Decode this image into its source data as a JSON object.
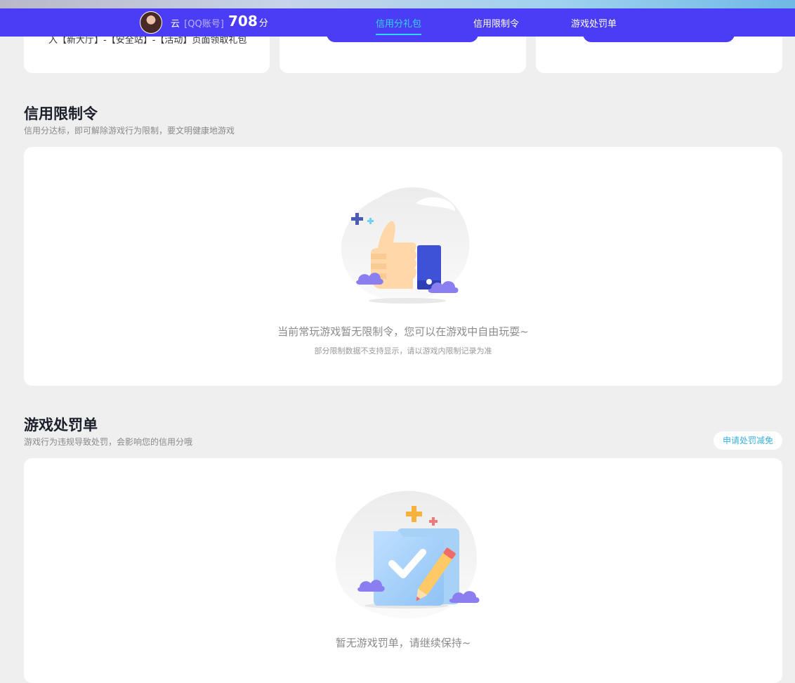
{
  "header": {
    "user_name": "云",
    "account_type": "[QQ账号]",
    "score": "708",
    "score_unit": "分",
    "tabs": [
      {
        "label": "信用分礼包",
        "active": true
      },
      {
        "label": "信用限制令",
        "active": false
      },
      {
        "label": "游戏处罚单",
        "active": false
      }
    ]
  },
  "gift_cards": {
    "card1_text": "入【新大厅】-【安全站】-【活动】页面领取礼包"
  },
  "restriction_section": {
    "title": "信用限制令",
    "subtitle": "信用分达标，即可解除游戏行为限制，要文明健康地游戏",
    "empty_main": "当前常玩游戏暂无限制令，您可以在游戏中自由玩耍~",
    "empty_sub": "部分限制数据不支持显示，请以游戏内限制记录为准"
  },
  "penalty_section": {
    "title": "游戏处罚单",
    "subtitle": "游戏行为违规导致处罚，会影响您的信用分哦",
    "action_label": "申请处罚减免",
    "empty_main": "暂无游戏罚单，请继续保持~"
  },
  "colors": {
    "brand": "#4b3df5",
    "active_tab": "#30d6f5",
    "link": "#3aaee0",
    "background": "#efefef"
  },
  "icons": {
    "restriction_illustration": "thumbs-up-illustration",
    "penalty_illustration": "clipboard-check-illustration"
  }
}
